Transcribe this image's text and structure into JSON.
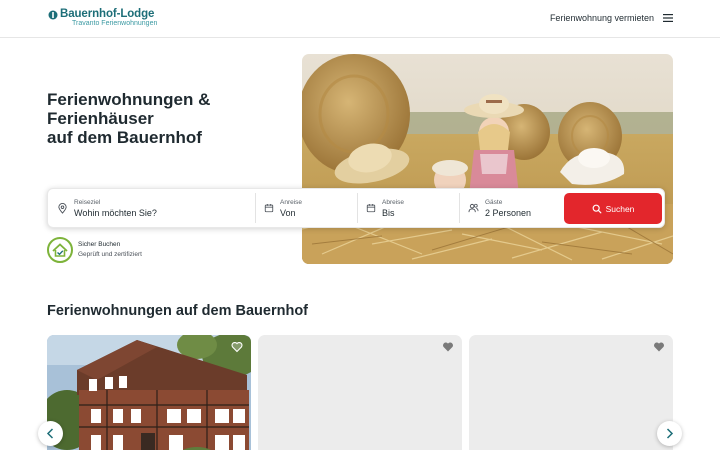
{
  "header": {
    "logo_title": "Bauernhof-Lodge",
    "logo_subtitle": "Travanto Ferienwohnungen",
    "rent_link": "Ferienwohnung vermieten",
    "menu_icon": "hamburger-menu-icon"
  },
  "hero": {
    "title_lines": [
      "Ferienwohnungen &",
      "Ferienhäuser",
      "auf dem Bauernhof"
    ]
  },
  "search": {
    "destination": {
      "label": "Reiseziel",
      "value": "Wohin möchten Sie?",
      "icon": "map-pin-icon"
    },
    "arrival": {
      "label": "Anreise",
      "value": "Von",
      "icon": "calendar-icon"
    },
    "departure": {
      "label": "Abreise",
      "value": "Bis",
      "icon": "calendar-icon"
    },
    "guests": {
      "label": "Gäste",
      "value": "2 Personen",
      "icon": "users-icon"
    },
    "button_label": "Suchen"
  },
  "trust": {
    "title": "Sicher Buchen",
    "subtitle": "Geprüft und zertifiziert"
  },
  "section": {
    "title": "Ferienwohnungen auf dem Bauernhof"
  },
  "colors": {
    "brand": "#1d6e78",
    "accent": "#e3262c",
    "badge_green": "#7db33a"
  }
}
